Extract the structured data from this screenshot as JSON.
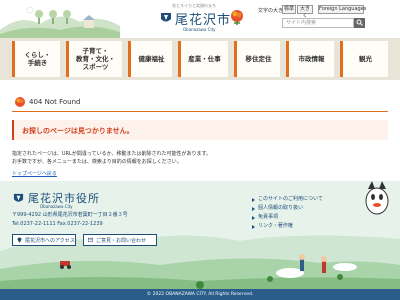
{
  "header": {
    "logo_tagline": "花とスイカと笑顔のまち",
    "logo_name": "尾花沢市",
    "logo_en": "Obanazawa City",
    "font_size_label": "文字の大きさ",
    "font_size_normal": "標準",
    "font_size_large": "大きく",
    "language_button": "Foreign Languages",
    "search_placeholder": "サイト内検索"
  },
  "nav": {
    "items": [
      {
        "label": "くらし・\n手続き"
      },
      {
        "label": "子育て・\n教育・文化・\nスポーツ"
      },
      {
        "label": "健康福祉"
      },
      {
        "label": "産業・仕事"
      },
      {
        "label": "移住定住"
      },
      {
        "label": "市政情報"
      },
      {
        "label": "観光"
      }
    ]
  },
  "main": {
    "not_found_title": "404 Not Found",
    "notice": "お探しのページは見つかりません。",
    "body_line1": "指定されたページは、URLが間違っているか、移動または削除された可能性があります。",
    "body_line2": "お手数ですが、各メニューまたは、検索より目的の情報をお探しください。",
    "top_link": "トップページへ戻る"
  },
  "footer": {
    "office_name": "尾花沢市役所",
    "office_en": "Obanazawa City",
    "address": "〒999-4292 山形県尾花沢市若葉町一丁目２番３号",
    "tel_fax": "Tel.0237-22-1111 Fax.0237-22-1239",
    "access_button": "尾花沢市へのアクセス",
    "contact_button": "ご意見・お問い合わせ",
    "links": [
      {
        "label": "このサイトのご利用について"
      },
      {
        "label": "個人情報の取り扱い"
      },
      {
        "label": "免責事項"
      },
      {
        "label": "リンク・著作権"
      }
    ],
    "copyright": "© 2022 OBANAZAWA CITY. All Rights Reserved."
  },
  "colors": {
    "accent_orange": "#e06e1c",
    "brand_blue": "#1f4e7a",
    "notice_red": "#d23f1a",
    "nav_bg": "#e8e5d8",
    "footer_bg": "#e6f2ea"
  },
  "icons": [
    "emblem-icon",
    "benibana-flower-icon",
    "search-icon",
    "flower-icon",
    "map-pin-icon",
    "mail-icon",
    "mascot-image"
  ]
}
